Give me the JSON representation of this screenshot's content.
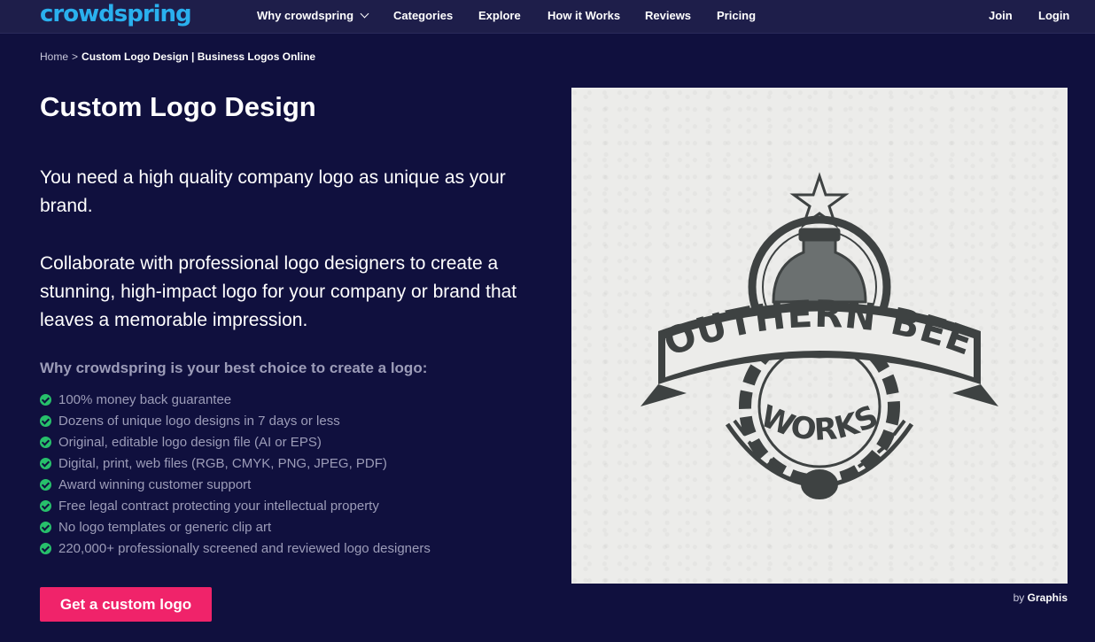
{
  "nav": {
    "logo": "crowdspring",
    "items": [
      {
        "label": "Why crowdspring"
      },
      {
        "label": "Categories"
      },
      {
        "label": "Explore"
      },
      {
        "label": "How it Works"
      },
      {
        "label": "Reviews"
      },
      {
        "label": "Pricing"
      }
    ],
    "join": "Join",
    "login": "Login"
  },
  "breadcrumb": {
    "home": "Home",
    "separator": ">",
    "current": "Custom Logo Design | Business Logos Online"
  },
  "title": "Custom Logo Design",
  "intro": [
    "You need a high quality company logo as unique as your brand.",
    "Collaborate with professional logo designers to create a stunning, high-impact logo for your company or brand that leaves a memorable impression."
  ],
  "why_heading": "Why crowdspring is your best choice to create a logo:",
  "features": [
    "100% money back guarantee",
    "Dozens of unique logo designs in 7 days or less",
    "Original, editable logo design file (AI or EPS)",
    "Digital, print, web files (RGB, CMYK, PNG, JPEG, PDF)",
    "Award winning customer support",
    "Free legal contract protecting your intellectual property",
    "No logo templates or generic clip art",
    "220,000+ professionally screened and reviewed logo designers"
  ],
  "cta": "Get a custom logo",
  "hero": {
    "banner_text": "SOUTHERN BEER",
    "sub_text": "WORKS",
    "credit_prefix": "by",
    "credit_name": "Graphis"
  },
  "colors": {
    "background": "#10103e",
    "nav_bg": "#1e1e4a",
    "brand": "#2ab0ee",
    "cta": "#f0236a",
    "check": "#27c06b"
  }
}
